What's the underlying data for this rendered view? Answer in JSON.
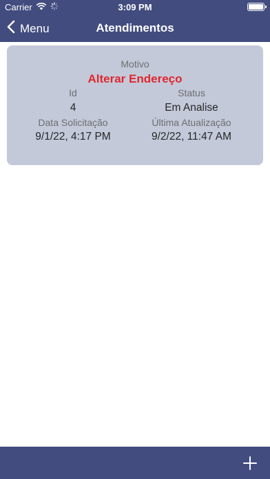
{
  "status_bar": {
    "carrier": "Carrier",
    "time": "3:09 PM"
  },
  "nav": {
    "back_label": "Menu",
    "title": "Atendimentos"
  },
  "card": {
    "motivo_label": "Motivo",
    "motivo_value": "Alterar Endereço",
    "id_label": "Id",
    "id_value": "4",
    "status_label": "Status",
    "status_value": "Em Analise",
    "data_label": "Data Solicitação",
    "data_value": "9/1/22, 4:17 PM",
    "atualizacao_label": "Última Atualização",
    "atualizacao_value": "9/2/22, 11:47 AM"
  },
  "colors": {
    "bar": "#424c7f",
    "card": "#c3c9d9",
    "accent": "#e0262d"
  },
  "icons": [
    "wifi-icon",
    "activity-spinner-icon",
    "battery-icon",
    "chevron-left-icon",
    "plus-icon"
  ]
}
